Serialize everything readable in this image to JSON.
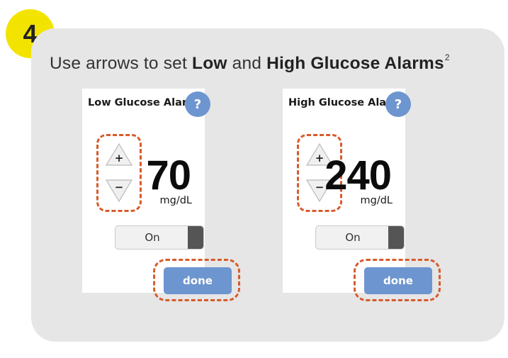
{
  "step": {
    "number": "4"
  },
  "instruction": {
    "prefix": "Use arrows to set ",
    "low_bold": "Low",
    "middle": " and ",
    "high_bold": "High Glucose Alarms",
    "superscript": "2"
  },
  "panels": [
    {
      "title": "Low Glucose Alarm",
      "help_label": "?",
      "up_symbol": "+",
      "down_symbol": "−",
      "value": "70",
      "unit": "mg/dL",
      "toggle_label": "On",
      "done_label": "done"
    },
    {
      "title": "High Glucose Alarm",
      "help_label": "?",
      "up_symbol": "+",
      "down_symbol": "−",
      "value": "240",
      "unit": "mg/dL",
      "toggle_label": "On",
      "done_label": "done"
    }
  ],
  "colors": {
    "badge": "#f2e400",
    "card_background": "#e6e6e6",
    "accent_blue": "#6d95cf",
    "highlight_dashed": "#d75b2c",
    "toggle_knob": "#555555"
  }
}
